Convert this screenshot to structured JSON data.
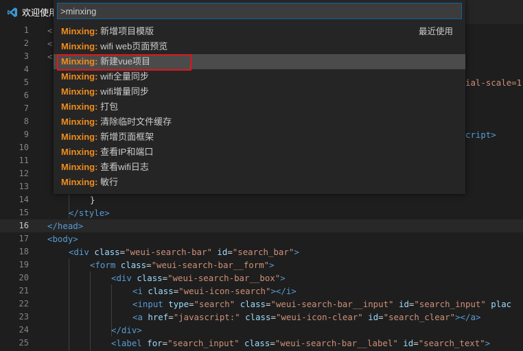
{
  "tab": {
    "label": "欢迎使用"
  },
  "palette": {
    "input_value": ">minxing",
    "items": [
      {
        "prefix": "Minxing:",
        "label": "新增项目模版",
        "detail": "最近使用"
      },
      {
        "prefix": "Minxing:",
        "label": "wifi web页面预览"
      },
      {
        "prefix": "Minxing:",
        "label": "新建vue项目"
      },
      {
        "prefix": "Minxing:",
        "label": "wifi全量同步"
      },
      {
        "prefix": "Minxing:",
        "label": "wifi增量同步"
      },
      {
        "prefix": "Minxing:",
        "label": "打包"
      },
      {
        "prefix": "Minxing:",
        "label": "清除临时文件缓存"
      },
      {
        "prefix": "Minxing:",
        "label": "新增页面框架"
      },
      {
        "prefix": "Minxing:",
        "label": "查看IP和端口"
      },
      {
        "prefix": "Minxing:",
        "label": "查看wifi日志"
      },
      {
        "prefix": "Minxing:",
        "label": "敏行"
      }
    ]
  },
  "editor": {
    "line_numbers": [
      "1",
      "2",
      "3",
      "4",
      "5",
      "6",
      "7",
      "8",
      "9",
      "10",
      "11",
      "12",
      "13",
      "14",
      "15",
      "16",
      "17",
      "18",
      "19",
      "20",
      "21",
      "22",
      "23",
      "24",
      "25"
    ],
    "fragments": {
      "l1": "<",
      "l2": "<",
      "l3": "<",
      "l5": "ial-scale=1",
      "l9": "cript>",
      "l14": "}",
      "l15": "</style>",
      "l16": "</head>",
      "l17": "<body>",
      "l18": {
        "open": "<div",
        "a1": "class",
        "v1": "\"weui-search-bar\"",
        "a2": "id",
        "v2": "\"search_bar\"",
        "close": ">"
      },
      "l19": {
        "open": "<form",
        "a1": "class",
        "v1": "\"weui-search-bar__form\"",
        "close": ">"
      },
      "l20": {
        "open": "<div",
        "a1": "class",
        "v1": "\"weui-search-bar__box\"",
        "close": ">"
      },
      "l21": {
        "open": "<i",
        "a1": "class",
        "v1": "\"weui-icon-search\"",
        "close": "></i>"
      },
      "l22": {
        "open": "<input",
        "a1": "type",
        "v1": "\"search\"",
        "a2": "class",
        "v2": "\"weui-search-bar__input\"",
        "a3": "id",
        "v3": "\"search_input\"",
        "a4": "plac"
      },
      "l23": {
        "open": "<a",
        "a1": "href",
        "v1": "\"javascript:\"",
        "a2": "class",
        "v2": "\"weui-icon-clear\"",
        "a3": "id",
        "v3": "\"search_clear\"",
        "close": "></a>"
      },
      "l24": "</div>",
      "l25": {
        "open": "<label",
        "a1": "for",
        "v1": "\"search_input\"",
        "a2": "class",
        "v2": "\"weui-search-bar__label\"",
        "a3": "id",
        "v3": "\"search_text\"",
        "close": ">"
      }
    }
  }
}
